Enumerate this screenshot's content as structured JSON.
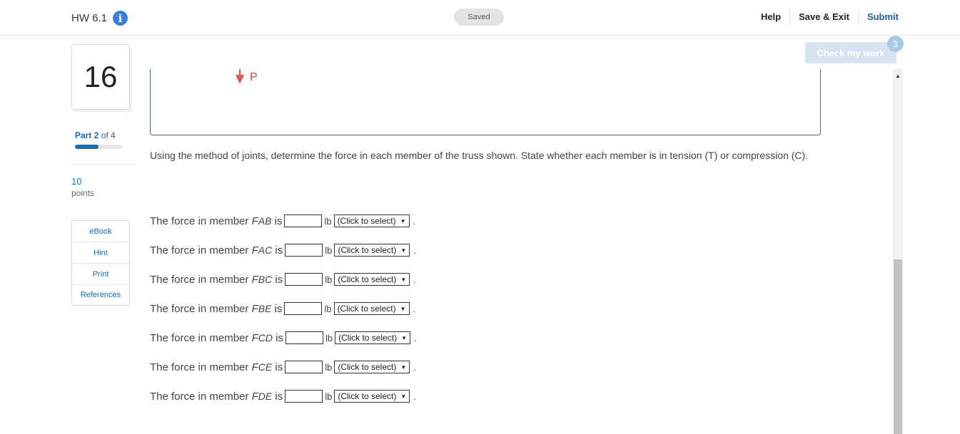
{
  "header": {
    "title": "HW 6.1",
    "info_icon": "i",
    "status": "Saved",
    "actions": [
      "Help",
      "Save & Exit",
      "Submit"
    ]
  },
  "left_rail": {
    "question_number": "16",
    "part_prefix": "Part 2",
    "part_suffix": "of 4",
    "part_progress": 0.5,
    "points_value": "10",
    "points_label": "points",
    "resources": [
      "eBook",
      "Hint",
      "Print",
      "References"
    ]
  },
  "check_work": {
    "label": "Check my work",
    "badge": "3"
  },
  "figure": {
    "force_label": "P",
    "arrow_color": "#e05555"
  },
  "question": {
    "text": "Using the method of joints, determine the force in each member of the truss shown. State whether each member is in tension (T) or compression (C)."
  },
  "rows": [
    {
      "prefix": "The force in member",
      "symbol": "F",
      "subscript": "AB",
      "is": "is",
      "unit": "lb",
      "select": "(Click to select)",
      "end": "."
    },
    {
      "prefix": "The force in member",
      "symbol": "F",
      "subscript": "AC",
      "is": "is",
      "unit": "lb",
      "select": "(Click to select)",
      "end": "."
    },
    {
      "prefix": "The force in member",
      "symbol": "F",
      "subscript": "BC",
      "is": "is",
      "unit": "lb",
      "select": "(Click to select)",
      "end": "."
    },
    {
      "prefix": "The force in member",
      "symbol": "F",
      "subscript": "BE",
      "is": "is",
      "unit": "lb",
      "select": "(Click to select)",
      "end": "."
    },
    {
      "prefix": "The force in member",
      "symbol": "F",
      "subscript": "CD",
      "is": "is",
      "unit": "lb",
      "select": "(Click to select)",
      "end": "."
    },
    {
      "prefix": "The force in member",
      "symbol": "F",
      "subscript": "CE",
      "is": "is",
      "unit": "lb",
      "select": "(Click to select)",
      "end": "."
    },
    {
      "prefix": "The force in member",
      "symbol": "F",
      "subscript": "DE",
      "is": "is",
      "unit": "lb",
      "select": "(Click to select)",
      "end": "."
    }
  ]
}
